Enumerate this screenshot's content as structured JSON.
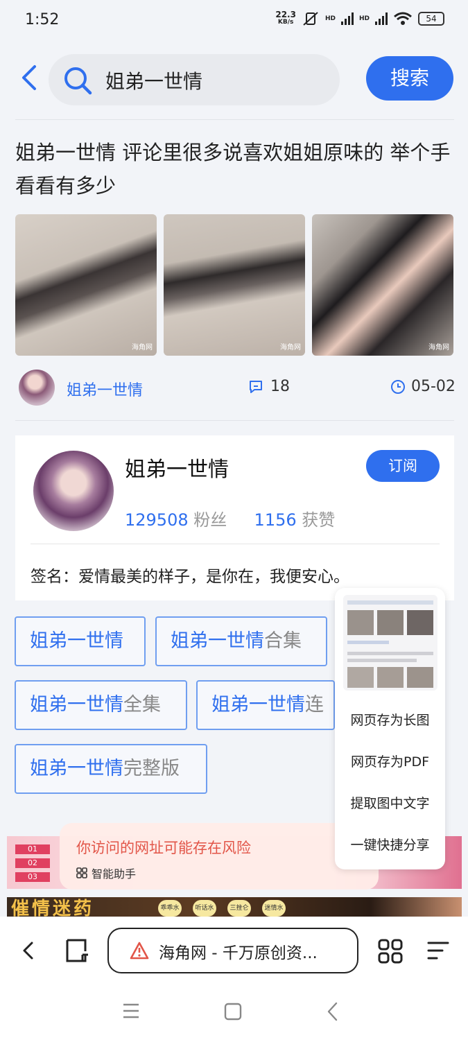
{
  "status_bar": {
    "time": "1:52",
    "net_speed": "22.3",
    "net_unit": "KB/s",
    "hd1": "HD",
    "hd2": "HD",
    "battery": "54"
  },
  "search": {
    "query": "姐弟一世情",
    "button": "搜索"
  },
  "article": {
    "title": "姐弟一世情 评论里很多说喜欢姐姐原味的 举个手看看有多少",
    "thumb_watermark": "海角网",
    "author": "姐弟一世情",
    "comments": "18",
    "date": "05-02"
  },
  "author_card": {
    "name": "姐弟一世情",
    "subscribe": "订阅",
    "followers_num": "129508",
    "followers_label": "粉丝",
    "likes_num": "1156",
    "likes_label": "获赞",
    "signature": "签名：爱情最美的样子，是你在，我便安心。"
  },
  "tags": [
    {
      "hl": "姐弟一世情",
      "rest": ""
    },
    {
      "hl": "姐弟一世情",
      "rest": "合集"
    },
    {
      "hl": "姐弟一世情",
      "rest": "全集"
    },
    {
      "hl": "姐弟一世情",
      "rest": "连"
    },
    {
      "hl": "姐弟一世情",
      "rest": "完整版"
    }
  ],
  "popup_menu": {
    "items": [
      "网页存为长图",
      "网页存为PDF",
      "提取图中文字",
      "一键快捷分享"
    ]
  },
  "ads": {
    "banner2_text": "催情迷药",
    "pills": [
      "乖乖水",
      "听话水",
      "三挫仑",
      "迷情水"
    ],
    "list_nums": [
      "01",
      "02",
      "03"
    ]
  },
  "warning": {
    "message": "你访问的网址可能存在风险",
    "assistant": "智能助手"
  },
  "toolbar": {
    "url_title": "海角网 - 千万原创资..."
  },
  "colors": {
    "accent": "#2f6fee",
    "warning": "#e25548"
  }
}
